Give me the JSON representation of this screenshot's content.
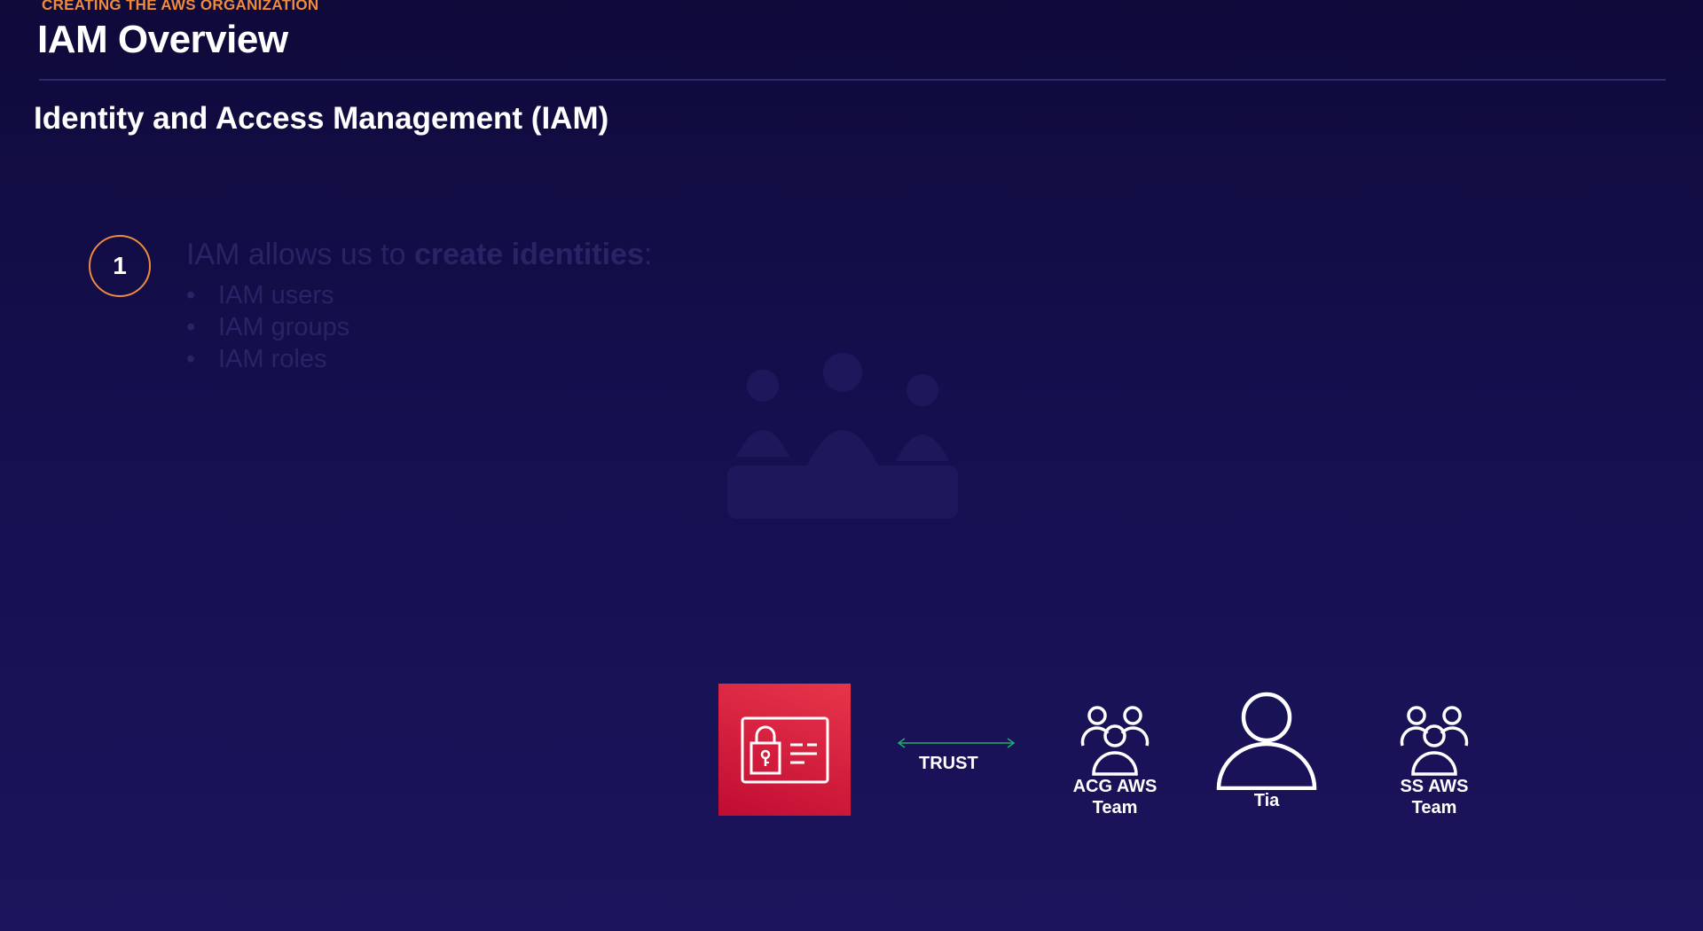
{
  "header": {
    "section_label": "CREATING THE AWS ORGANIZATION",
    "title": "IAM Overview"
  },
  "subtitle": "Identity and Access Management (IAM)",
  "step": {
    "number": "1",
    "intro_prefix": "IAM allows us to ",
    "intro_emphasis": "create identities",
    "intro_suffix": ":",
    "items": [
      "IAM users",
      "IAM groups",
      "IAM roles"
    ]
  },
  "diagram": {
    "service_icon": "iam-credential-icon",
    "connector_label": "TRUST",
    "connector_color": "#1fae6b",
    "tile_color": "#d41f3f",
    "accent_color": "#f08a3c",
    "actors": [
      {
        "label": "ACG AWS\nTeam",
        "icon": "group-icon"
      },
      {
        "label": "Tia",
        "icon": "user-icon"
      },
      {
        "label": "SS AWS\nTeam",
        "icon": "group-icon"
      }
    ]
  }
}
